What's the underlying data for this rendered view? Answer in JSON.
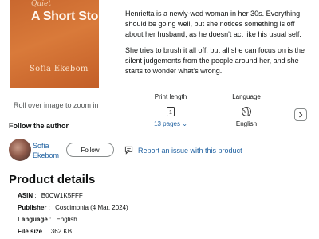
{
  "cover": {
    "top_text": "Quiet",
    "title": "A Short Story",
    "author": "Sofia Ekebom"
  },
  "zoom_hint": "Roll over image to zoom in",
  "description": {
    "paragraph1": "Henrietta is a newly-wed woman in her 30s. Everything should be going well, but she notices something is off about her husband, as he doesn't act like his usual self.",
    "paragraph2": "She tries to brush it all off, but all she can focus on is the silent judgements from the people around her, and she starts to wonder what's wrong."
  },
  "attributes": [
    {
      "label": "Print length",
      "value": "13 pages",
      "icon": "book-pages-icon"
    },
    {
      "label": "Language",
      "value": "English",
      "icon": "globe-icon"
    }
  ],
  "follow": {
    "heading": "Follow the author",
    "author_name": "Sofia Ekebom",
    "button_label": "Follow"
  },
  "report_label": "Report an issue with this product",
  "details": {
    "title": "Product details",
    "rows": [
      {
        "key": "ASIN",
        "value": "B0CW1K5FFF"
      },
      {
        "key": "Publisher",
        "value": "Coscimonia (4 Mar. 2024)"
      },
      {
        "key": "Language",
        "value": "English"
      },
      {
        "key": "File size",
        "value": "362 KB"
      }
    ]
  },
  "colors": {
    "link": "#2162a1",
    "text": "#0f1111",
    "cover": "#d0703a"
  }
}
